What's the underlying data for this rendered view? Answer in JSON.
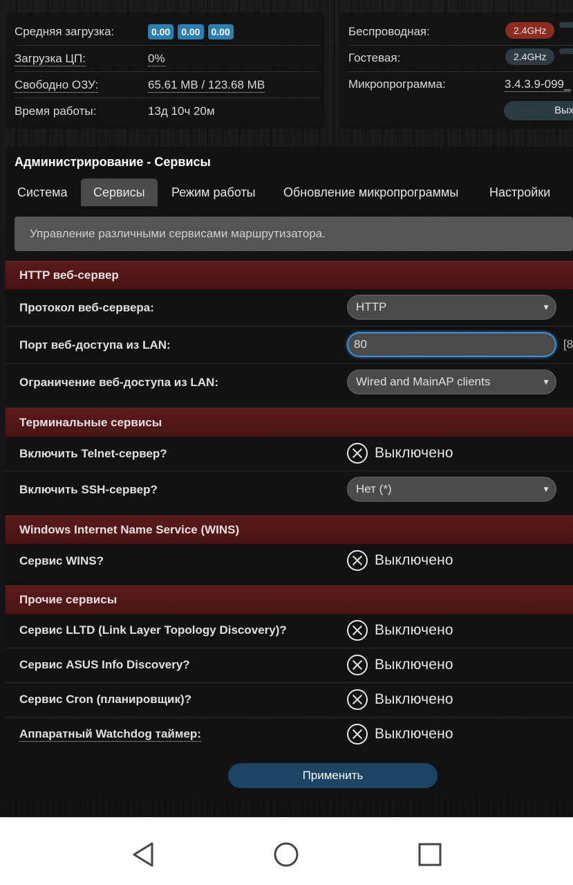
{
  "status_left": {
    "avg_load_label": "Средняя загрузка:",
    "avg_load_values": [
      "0.00",
      "0.00",
      "0.00"
    ],
    "cpu_label": "Загрузка ЦП:",
    "cpu_value": "0%",
    "ram_label": "Свободно ОЗУ:",
    "ram_value": "65.61 MB / 123.68 MB",
    "uptime_label": "Время работы:",
    "uptime_value": "13д 10ч 20м"
  },
  "status_right": {
    "wireless_label": "Беспроводная:",
    "wireless_band": "2.4GHz",
    "guest_label": "Гостевая:",
    "guest_band": "2.4GHz",
    "firmware_label": "Микропрограмма:",
    "firmware_value": "3.4.3.9-099_",
    "logout_label": "Выход"
  },
  "page": {
    "title": "Администрирование - Сервисы",
    "tabs": [
      "Система",
      "Сервисы",
      "Режим работы",
      "Обновление микропрограммы",
      "Настройки"
    ],
    "active_tab": "Сервисы",
    "description": "Управление различными сервисами маршрутизатора."
  },
  "http_section": {
    "title": "HTTP веб-сервер",
    "protocol_label": "Протокол веб-сервера:",
    "protocol_value": "HTTP",
    "port_label": "Порт веб-доступа из LAN:",
    "port_value": "80",
    "port_hint": "[8",
    "restrict_label": "Ограничение веб-доступа из LAN:",
    "restrict_value": "Wired and MainAP clients"
  },
  "terminal_section": {
    "title": "Терминальные сервисы",
    "telnet_label": "Включить Telnet-сервер?",
    "telnet_value": "Выключено",
    "ssh_label": "Включить SSH-сервер?",
    "ssh_value": "Нет (*)"
  },
  "wins_section": {
    "title": "Windows Internet Name Service (WINS)",
    "wins_label": "Сервис WINS?",
    "wins_value": "Выключено"
  },
  "other_section": {
    "title": "Прочие сервисы",
    "lltd_label": "Сервис LLTD (Link Layer Topology Discovery)?",
    "lltd_value": "Выключено",
    "asus_label": "Сервис ASUS Info Discovery?",
    "asus_value": "Выключено",
    "cron_label": "Сервис Cron (планировщик)?",
    "cron_value": "Выключено",
    "watchdog_label": "Аппаратный Watchdog таймер:",
    "watchdog_value": "Выключено"
  },
  "apply_label": "Применить",
  "colors": {
    "accent_blue": "#2b7fb0",
    "section_red": "#5a1a1a",
    "band_red": "#8c2b20"
  }
}
